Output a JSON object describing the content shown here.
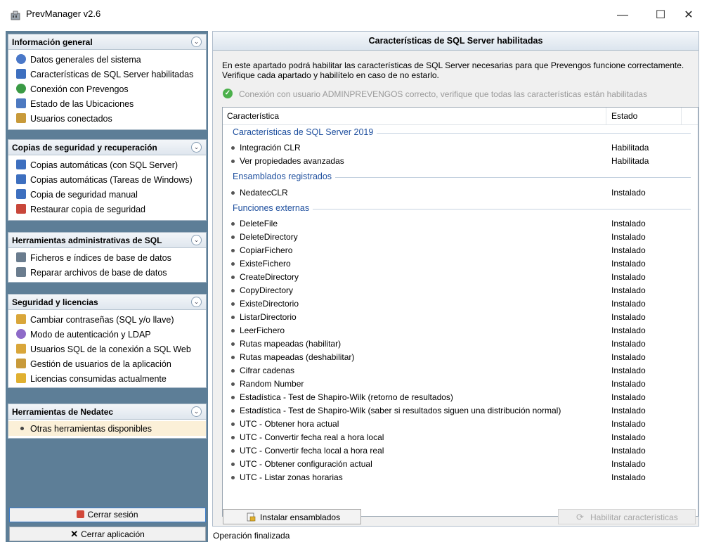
{
  "window": {
    "title": "PrevManager v2.6",
    "minimize": "—",
    "maximize": "☐",
    "close": "✕"
  },
  "sidebar": {
    "collapse_glyph": "⌄",
    "groups": [
      {
        "title": "Información general",
        "items": [
          {
            "label": "Datos generales del sistema",
            "icon": "info-icon",
            "color": "#4a78c8"
          },
          {
            "label": "Características de SQL Server habilitadas",
            "icon": "database-settings-icon",
            "color": "#3d6fbf"
          },
          {
            "label": "Conexión con Prevengos",
            "icon": "connection-icon",
            "color": "#3a9a45"
          },
          {
            "label": "Estado de las Ubicaciones",
            "icon": "folder-status-icon",
            "color": "#4d79c0"
          },
          {
            "label": "Usuarios conectados",
            "icon": "users-icon",
            "color": "#c89a3a"
          }
        ]
      },
      {
        "title": "Copias de seguridad y recuperación",
        "items": [
          {
            "label": "Copias automáticas (con SQL Server)",
            "icon": "backup-icon",
            "color": "#3d6fbf"
          },
          {
            "label": "Copias automáticas (Tareas de Windows)",
            "icon": "backup-schedule-icon",
            "color": "#3d6fbf"
          },
          {
            "label": "Copia de seguridad manual",
            "icon": "manual-backup-icon",
            "color": "#3d6fbf"
          },
          {
            "label": "Restaurar copia de seguridad",
            "icon": "restore-icon",
            "color": "#c8463a"
          }
        ]
      },
      {
        "title": "Herramientas administrativas de SQL",
        "items": [
          {
            "label": "Ficheros e índices de base de datos",
            "icon": "database-files-icon",
            "color": "#6a7c8e"
          },
          {
            "label": "Reparar archivos de base de datos",
            "icon": "repair-icon",
            "color": "#6a7c8e"
          }
        ]
      },
      {
        "title": "Seguridad y licencias",
        "items": [
          {
            "label": "Cambiar contraseñas (SQL y/o llave)",
            "icon": "key-icon",
            "color": "#d9a63a"
          },
          {
            "label": "Modo de autenticación y LDAP",
            "icon": "ldap-icon",
            "color": "#8e6ac8"
          },
          {
            "label": "Usuarios SQL de la conexión a SQL Web",
            "icon": "key-users-icon",
            "color": "#d9a63a"
          },
          {
            "label": "Gestión de usuarios de la aplicación",
            "icon": "user-management-icon",
            "color": "#c89a3a"
          },
          {
            "label": "Licencias consumidas actualmente",
            "icon": "license-icon",
            "color": "#e0b030"
          }
        ]
      },
      {
        "title": "Herramientas de Nedatec",
        "items": [
          {
            "label": "Otras herramientas disponibles",
            "icon": "bullet-icon",
            "color": "#444444"
          }
        ]
      }
    ],
    "logout_label": "Cerrar sesión",
    "close_app_label": "Cerrar aplicación"
  },
  "main": {
    "header": "Características de SQL Server habilitadas",
    "intro": "En este apartado podrá habilitar las características de SQL Server necesarias para que Prevengos funcione correctamente. Verifique cada apartado y habilítelo en caso de no estarlo.",
    "connection_status": "Conexión con usuario ADMINPREVENGOS correcto, verifique que todas las características están habilitadas",
    "list": {
      "columns": [
        "Característica",
        "Estado"
      ],
      "groups": [
        {
          "title": "Características de SQL Server 2019",
          "rows": [
            {
              "name": "Integración CLR",
              "state": "Habilitada"
            },
            {
              "name": "Ver propiedades avanzadas",
              "state": "Habilitada"
            }
          ]
        },
        {
          "title": "Ensamblados registrados",
          "rows": [
            {
              "name": "NedatecCLR",
              "state": "Instalado"
            }
          ]
        },
        {
          "title": "Funciones externas",
          "rows": [
            {
              "name": "DeleteFile",
              "state": "Instalado"
            },
            {
              "name": "DeleteDirectory",
              "state": "Instalado"
            },
            {
              "name": "CopiarFichero",
              "state": "Instalado"
            },
            {
              "name": "ExisteFichero",
              "state": "Instalado"
            },
            {
              "name": "CreateDirectory",
              "state": "Instalado"
            },
            {
              "name": "CopyDirectory",
              "state": "Instalado"
            },
            {
              "name": "ExisteDirectorio",
              "state": "Instalado"
            },
            {
              "name": "ListarDirectorio",
              "state": "Instalado"
            },
            {
              "name": "LeerFichero",
              "state": "Instalado"
            },
            {
              "name": "Rutas mapeadas (habilitar)",
              "state": "Instalado"
            },
            {
              "name": "Rutas mapeadas (deshabilitar)",
              "state": "Instalado"
            },
            {
              "name": "Cifrar cadenas",
              "state": "Instalado"
            },
            {
              "name": "Random Number",
              "state": "Instalado"
            },
            {
              "name": "Estadística - Test de Shapiro-Wilk (retorno de resultados)",
              "state": "Instalado"
            },
            {
              "name": "Estadística - Test de Shapiro-Wilk (saber si resultados siguen una distribución normal)",
              "state": "Instalado"
            },
            {
              "name": "UTC - Obtener hora actual",
              "state": "Instalado"
            },
            {
              "name": "UTC - Convertir fecha real a hora local",
              "state": "Instalado"
            },
            {
              "name": "UTC - Convertir fecha local a hora real",
              "state": "Instalado"
            },
            {
              "name": "UTC - Obtener configuración actual",
              "state": "Instalado"
            },
            {
              "name": "UTC - Listar zonas horarias",
              "state": "Instalado"
            }
          ]
        }
      ]
    },
    "install_button": "Instalar ensamblados",
    "enable_button": "Habilitar características"
  },
  "statusbar": {
    "text": "Operación finalizada"
  }
}
